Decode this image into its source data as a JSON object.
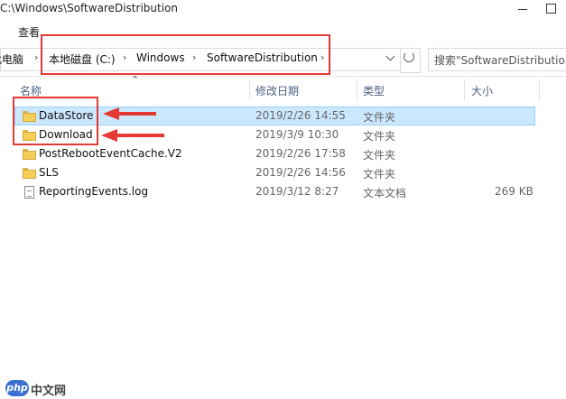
{
  "window": {
    "title": "C:\\Windows\\SoftwareDistribution"
  },
  "ribbon": {
    "tabs": [
      {
        "label": "查看"
      }
    ]
  },
  "address": {
    "crumbs": [
      "此电脑",
      "本地磁盘 (C:)",
      "Windows",
      "SoftwareDistribution"
    ],
    "separator": "›"
  },
  "search": {
    "placeholder": "搜索\"SoftwareDistribution\""
  },
  "columns": {
    "name": "名称",
    "date": "修改日期",
    "type": "类型",
    "size": "大小"
  },
  "files": [
    {
      "name": "DataStore",
      "date": "2019/2/26 14:55",
      "type": "文件夹",
      "size": "",
      "icon": "folder-icon",
      "selected": true
    },
    {
      "name": "Download",
      "date": "2019/3/9 10:30",
      "type": "文件夹",
      "size": "",
      "icon": "folder-icon",
      "selected": false
    },
    {
      "name": "PostRebootEventCache.V2",
      "date": "2019/2/26 17:58",
      "type": "文件夹",
      "size": "",
      "icon": "folder-icon",
      "selected": false
    },
    {
      "name": "SLS",
      "date": "2019/2/26 14:56",
      "type": "文件夹",
      "size": "",
      "icon": "folder-icon",
      "selected": false
    },
    {
      "name": "ReportingEvents.log",
      "date": "2019/3/12 8:27",
      "type": "文本文档",
      "size": "269 KB",
      "icon": "file-icon",
      "selected": false
    }
  ],
  "watermark": {
    "logo": "php",
    "text": "中文网"
  },
  "colors": {
    "annotation": "#e53935",
    "selection": "#cce8ff",
    "header_text": "#4d6082"
  }
}
